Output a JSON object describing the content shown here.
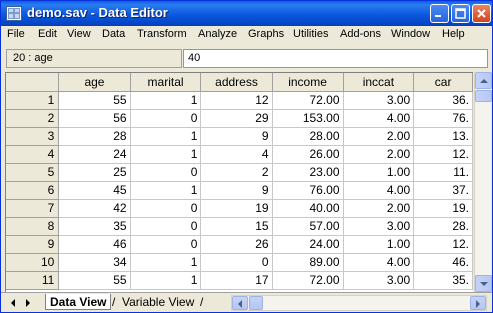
{
  "window": {
    "title": "demo.sav - Data Editor",
    "title_bar_color": "#0b58df"
  },
  "menubar": {
    "items": [
      "File",
      "Edit",
      "View",
      "Data",
      "Transform",
      "Analyze",
      "Graphs",
      "Utilities",
      "Add-ons",
      "Window",
      "Help"
    ]
  },
  "cell_editor": {
    "reference": "20 : age",
    "value": "40"
  },
  "grid": {
    "columns": [
      "age",
      "marital",
      "address",
      "income",
      "inccat",
      "car"
    ],
    "rows": [
      {
        "n": "1",
        "cells": [
          "55",
          "1",
          "12",
          "72.00",
          "3.00",
          "36."
        ]
      },
      {
        "n": "2",
        "cells": [
          "56",
          "0",
          "29",
          "153.00",
          "4.00",
          "76."
        ]
      },
      {
        "n": "3",
        "cells": [
          "28",
          "1",
          "9",
          "28.00",
          "2.00",
          "13."
        ]
      },
      {
        "n": "4",
        "cells": [
          "24",
          "1",
          "4",
          "26.00",
          "2.00",
          "12."
        ]
      },
      {
        "n": "5",
        "cells": [
          "25",
          "0",
          "2",
          "23.00",
          "1.00",
          "11."
        ]
      },
      {
        "n": "6",
        "cells": [
          "45",
          "1",
          "9",
          "76.00",
          "4.00",
          "37."
        ]
      },
      {
        "n": "7",
        "cells": [
          "42",
          "0",
          "19",
          "40.00",
          "2.00",
          "19."
        ]
      },
      {
        "n": "8",
        "cells": [
          "35",
          "0",
          "15",
          "57.00",
          "3.00",
          "28."
        ]
      },
      {
        "n": "9",
        "cells": [
          "46",
          "0",
          "26",
          "24.00",
          "1.00",
          "12."
        ]
      },
      {
        "n": "10",
        "cells": [
          "34",
          "1",
          "0",
          "89.00",
          "4.00",
          "46."
        ]
      },
      {
        "n": "11",
        "cells": [
          "55",
          "1",
          "17",
          "72.00",
          "3.00",
          "35."
        ]
      }
    ]
  },
  "tabs": {
    "data_view": "Data View",
    "variable_view": "Variable View",
    "separator": "/"
  }
}
